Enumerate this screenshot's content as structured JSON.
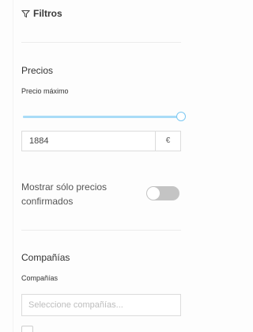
{
  "filters": {
    "title": "Filtros",
    "icon": "funnel-icon"
  },
  "prices": {
    "section_title": "Precios",
    "max_price_label": "Precio máximo",
    "slider_level": 1.0,
    "max_price_value": "1884",
    "currency": "€",
    "confirmed_only_label": "Mostrar sólo precios confirmados",
    "confirmed_only_enabled": false
  },
  "companies": {
    "section_title": "Compañías",
    "label": "Compañías",
    "placeholder": "Seleccione compañías..."
  },
  "colors": {
    "slider_track": "#a9dcf7",
    "slider_thumb_border": "#7cc8f2",
    "toggle_off": "#c4c4c4",
    "divider": "#ececec"
  }
}
